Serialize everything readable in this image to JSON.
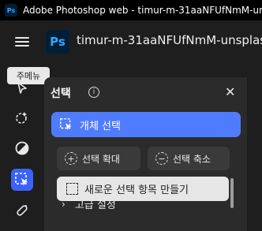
{
  "window": {
    "title": "Adobe Photoshop web - timur-m-31aaNFUfNmM-unsplash"
  },
  "app": {
    "logo": "Ps",
    "filename": "timur-m-31aaNFUfNmM-unsplash"
  },
  "tooltip": {
    "text": "주메뉴"
  },
  "tools": [
    {
      "name": "move-tool",
      "icon": "cursor-icon"
    },
    {
      "name": "quick-select-tool",
      "icon": "magic-select-icon"
    },
    {
      "name": "adjust-tool",
      "icon": "contrast-icon"
    },
    {
      "name": "object-select-tool",
      "icon": "object-select-icon",
      "active": true
    },
    {
      "name": "healing-tool",
      "icon": "bandage-icon"
    }
  ],
  "panel": {
    "title": "선택",
    "info": "i",
    "close": "✕",
    "primary_button": "개체 선택",
    "expand_button": "선택 확대",
    "contract_button": "선택 축소",
    "new_selection_button": "새로운 선택 항목 만들기",
    "advanced_label": "고급 설정"
  },
  "colors": {
    "accent": "#4f7cff",
    "active_tool": "#3b63f5",
    "ps_blue": "#31a8ff"
  }
}
